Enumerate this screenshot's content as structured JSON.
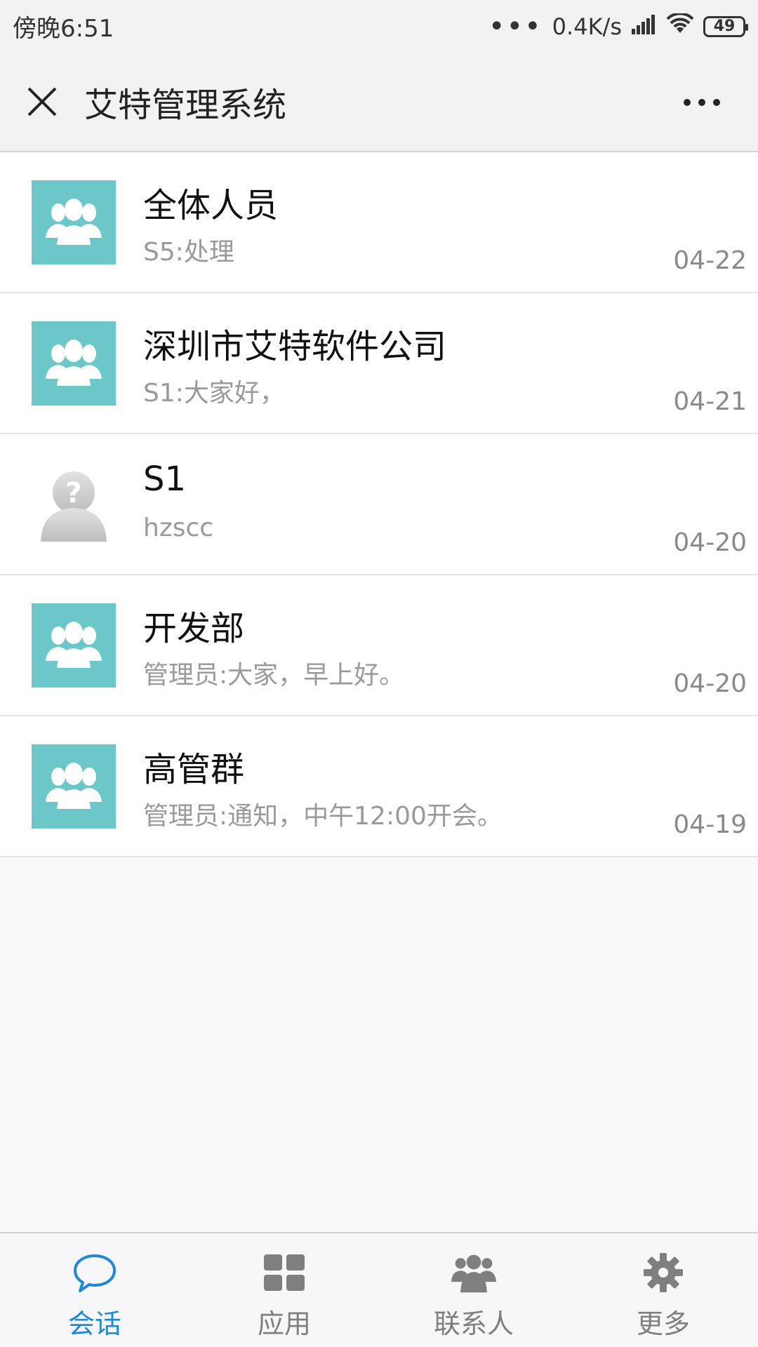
{
  "status_bar": {
    "time": "傍晚6:51",
    "more_dots": "•••",
    "speed": "0.4K/s",
    "battery": "49"
  },
  "header": {
    "title": "艾特管理系统"
  },
  "conversations": [
    {
      "name": "全体人员",
      "preview": "S5:处理",
      "time": "04-22",
      "avatar": "group-icon"
    },
    {
      "name": "深圳市艾特软件公司",
      "preview": "S1:大家好，",
      "time": "04-21",
      "avatar": "group-icon"
    },
    {
      "name": "S1",
      "preview": "hzscc",
      "time": "04-20",
      "avatar": "unknown-user-icon"
    },
    {
      "name": "开发部",
      "preview": "管理员:大家，早上好。",
      "time": "04-20",
      "avatar": "group-icon"
    },
    {
      "name": "高管群",
      "preview": "管理员:通知，中午12:00开会。",
      "time": "04-19",
      "avatar": "group-icon"
    }
  ],
  "tabs": [
    {
      "label": "会话",
      "icon": "chat-bubble-icon",
      "active": true
    },
    {
      "label": "应用",
      "icon": "grid-icon",
      "active": false
    },
    {
      "label": "联系人",
      "icon": "contacts-icon",
      "active": false
    },
    {
      "label": "更多",
      "icon": "gear-icon",
      "active": false
    }
  ],
  "colors": {
    "accent": "#1c8ad6",
    "avatar_bg": "#6cc7c8"
  }
}
